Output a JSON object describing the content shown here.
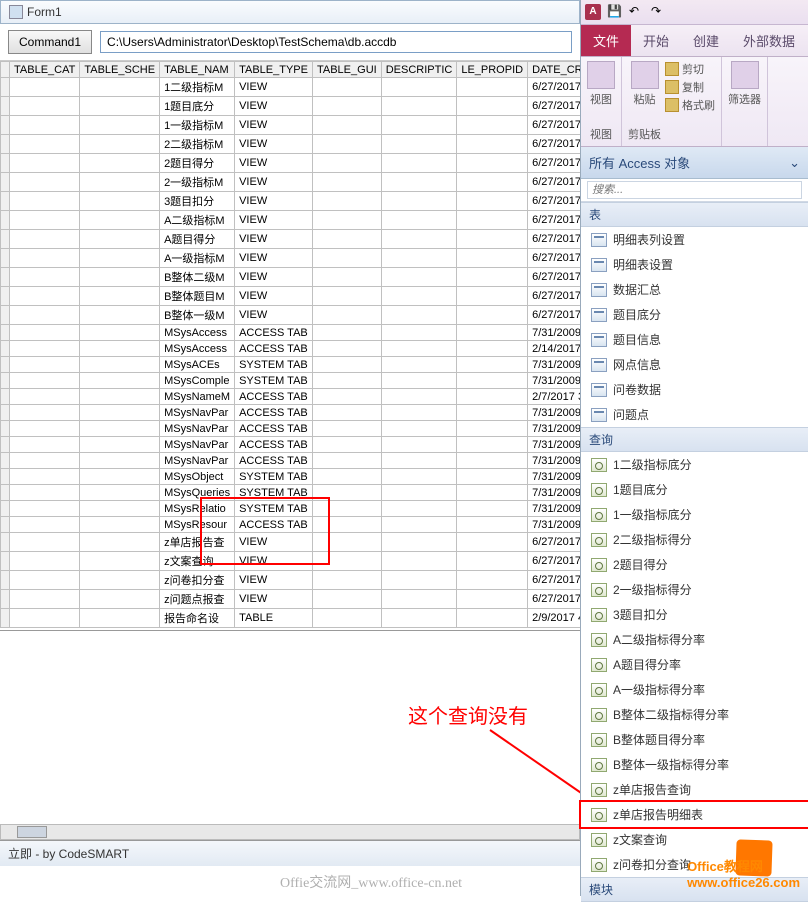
{
  "form": {
    "title": "Form1"
  },
  "toolbar": {
    "command_label": "Command1",
    "path_value": "C:\\Users\\Administrator\\Desktop\\TestSchema\\db.accdb"
  },
  "grid": {
    "headers": [
      "TABLE_CAT",
      "TABLE_SCHE",
      "TABLE_NAM",
      "TABLE_TYPE",
      "TABLE_GUI",
      "DESCRIPTIC",
      "LE_PROPID",
      "DATE_CRE"
    ],
    "rows": [
      {
        "name": "1二级指标M",
        "type": "VIEW",
        "date": "6/27/2017"
      },
      {
        "name": "1题目底分",
        "type": "VIEW",
        "date": "6/27/2017"
      },
      {
        "name": "1一级指标M",
        "type": "VIEW",
        "date": "6/27/2017"
      },
      {
        "name": "2二级指标M",
        "type": "VIEW",
        "date": "6/27/2017"
      },
      {
        "name": "2题目得分",
        "type": "VIEW",
        "date": "6/27/2017"
      },
      {
        "name": "2一级指标M",
        "type": "VIEW",
        "date": "6/27/2017"
      },
      {
        "name": "3题目扣分",
        "type": "VIEW",
        "date": "6/27/2017"
      },
      {
        "name": "A二级指标M",
        "type": "VIEW",
        "date": "6/27/2017"
      },
      {
        "name": "A题目得分",
        "type": "VIEW",
        "date": "6/27/2017"
      },
      {
        "name": "A一级指标M",
        "type": "VIEW",
        "date": "6/27/2017"
      },
      {
        "name": "B整体二级M",
        "type": "VIEW",
        "date": "6/27/2017"
      },
      {
        "name": "B整体题目M",
        "type": "VIEW",
        "date": "6/27/2017"
      },
      {
        "name": "B整体一级M",
        "type": "VIEW",
        "date": "6/27/2017"
      },
      {
        "name": "MSysAccess",
        "type": "ACCESS TAB",
        "date": "7/31/2009"
      },
      {
        "name": "MSysAccess",
        "type": "ACCESS TAB",
        "date": "2/14/2017"
      },
      {
        "name": "MSysACEs",
        "type": "SYSTEM TAB",
        "date": "7/31/2009"
      },
      {
        "name": "MSysComple",
        "type": "SYSTEM TAB",
        "date": "7/31/2009"
      },
      {
        "name": "MSysNameM",
        "type": "ACCESS TAB",
        "date": "2/7/2017 3"
      },
      {
        "name": "MSysNavPar",
        "type": "ACCESS TAB",
        "date": "7/31/2009"
      },
      {
        "name": "MSysNavPar",
        "type": "ACCESS TAB",
        "date": "7/31/2009"
      },
      {
        "name": "MSysNavPar",
        "type": "ACCESS TAB",
        "date": "7/31/2009"
      },
      {
        "name": "MSysNavPar",
        "type": "ACCESS TAB",
        "date": "7/31/2009"
      },
      {
        "name": "MSysObject",
        "type": "SYSTEM TAB",
        "date": "7/31/2009"
      },
      {
        "name": "MSysQueries",
        "type": "SYSTEM TAB",
        "date": "7/31/2009"
      },
      {
        "name": "MSysRelatio",
        "type": "SYSTEM TAB",
        "date": "7/31/2009"
      },
      {
        "name": "MSysResour",
        "type": "ACCESS TAB",
        "date": "7/31/2009"
      },
      {
        "name": "z单店报告查",
        "type": "VIEW",
        "date": "6/27/2017"
      },
      {
        "name": "z文案查询",
        "type": "VIEW",
        "date": "6/27/2017"
      },
      {
        "name": "z问卷扣分查",
        "type": "VIEW",
        "date": "6/27/2017"
      },
      {
        "name": "z问题点报查",
        "type": "VIEW",
        "date": "6/27/2017"
      },
      {
        "name": "报告命名设",
        "type": "TABLE",
        "date": "2/9/2017 4"
      }
    ]
  },
  "immediate": {
    "label": "立即 - by CodeSMART"
  },
  "annotation": {
    "text": "这个查询没有"
  },
  "access": {
    "qat_icon": "A",
    "tabs": {
      "file": "文件",
      "home": "开始",
      "create": "创建",
      "external": "外部数据"
    },
    "ribbon": {
      "view": "视图",
      "paste": "粘贴",
      "cut": "剪切",
      "copy": "复制",
      "format": "格式刷",
      "filter": "筛选器",
      "group_view": "视图",
      "group_clipboard": "剪贴板"
    },
    "nav_title": "所有 Access 对象",
    "search_placeholder": "搜索...",
    "cat_table": "表",
    "tables": [
      "明细表列设置",
      "明细表设置",
      "数据汇总",
      "题目底分",
      "题目信息",
      "网点信息",
      "问卷数据",
      "问题点"
    ],
    "cat_query": "查询",
    "queries": [
      "1二级指标底分",
      "1题目底分",
      "1一级指标底分",
      "2二级指标得分",
      "2题目得分",
      "2一级指标得分",
      "3题目扣分",
      "A二级指标得分率",
      "A题目得分率",
      "A一级指标得分率",
      "B整体二级指标得分率",
      "B整体题目得分率",
      "B整体一级指标得分率",
      "z单店报告查询",
      "z单店报告明细表",
      "z文案查询",
      "z问卷扣分查询"
    ],
    "cat_module": "模块"
  },
  "watermark": {
    "w1": "Offie交流网_www.office-cn.net",
    "w2": "www.office26.com",
    "w2_title": "Office教程网"
  }
}
